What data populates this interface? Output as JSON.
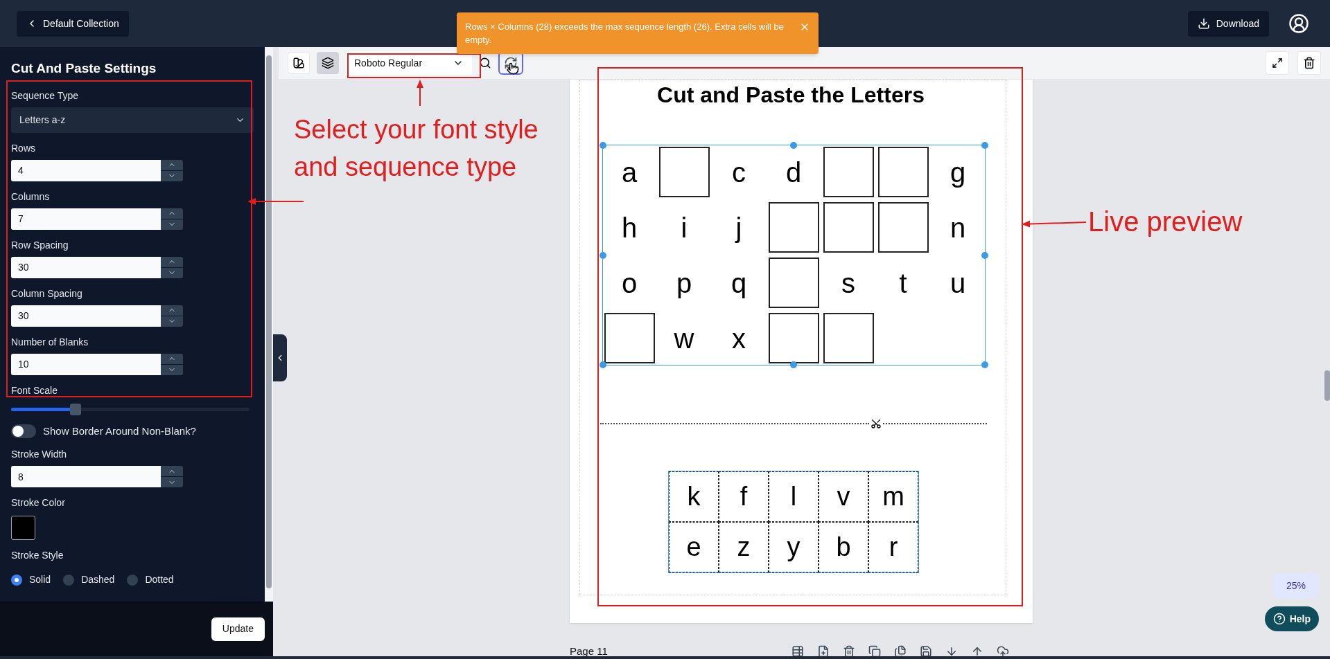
{
  "top_bar": {
    "back_button": "Default Collection",
    "download_button": "Download"
  },
  "settings_panel": {
    "title": "Cut And Paste Settings",
    "fields": [
      {
        "kind": "select",
        "label": "Sequence Type",
        "value": "Letters a-z"
      },
      {
        "kind": "number",
        "label": "Rows",
        "value": "4"
      },
      {
        "kind": "number",
        "label": "Columns",
        "value": "7"
      },
      {
        "kind": "number",
        "label": "Row Spacing",
        "value": "30"
      },
      {
        "kind": "number",
        "label": "Column Spacing",
        "value": "30"
      },
      {
        "kind": "number",
        "label": "Number of Blanks",
        "value": "10"
      },
      {
        "kind": "slider",
        "label": "Font Scale",
        "level": 0.27
      },
      {
        "kind": "toggle",
        "label": "Show Border Around Non-Blank?",
        "on": false
      },
      {
        "kind": "number",
        "label": "Stroke Width",
        "value": "8"
      },
      {
        "kind": "color",
        "label": "Stroke Color",
        "color": "#000000"
      },
      {
        "kind": "radio",
        "label": "Stroke Style",
        "options": [
          {
            "label": "Solid",
            "selected": true
          },
          {
            "label": "Dashed",
            "selected": false
          },
          {
            "label": "Dotted",
            "selected": false
          }
        ]
      }
    ],
    "update_button": "Update"
  },
  "toolbar": {
    "font_select": "Roboto Regular"
  },
  "toast": {
    "message": "Rows × Columns (28) exceeds the max sequence length (26). Extra cells will be empty."
  },
  "worksheet": {
    "title": "Cut and Paste the Letters",
    "grid": [
      [
        {
          "kind": "letter",
          "text": "a"
        },
        {
          "kind": "blank"
        },
        {
          "kind": "letter",
          "text": "c"
        },
        {
          "kind": "letter",
          "text": "d"
        },
        {
          "kind": "blank"
        },
        {
          "kind": "blank"
        },
        {
          "kind": "letter",
          "text": "g"
        }
      ],
      [
        {
          "kind": "letter",
          "text": "h"
        },
        {
          "kind": "letter",
          "text": "i"
        },
        {
          "kind": "letter",
          "text": "j"
        },
        {
          "kind": "blank"
        },
        {
          "kind": "blank"
        },
        {
          "kind": "blank"
        },
        {
          "kind": "letter",
          "text": "n"
        }
      ],
      [
        {
          "kind": "letter",
          "text": "o"
        },
        {
          "kind": "letter",
          "text": "p"
        },
        {
          "kind": "letter",
          "text": "q"
        },
        {
          "kind": "blank"
        },
        {
          "kind": "letter",
          "text": "s"
        },
        {
          "kind": "letter",
          "text": "t"
        },
        {
          "kind": "letter",
          "text": "u"
        }
      ],
      [
        {
          "kind": "blank"
        },
        {
          "kind": "letter",
          "text": "w"
        },
        {
          "kind": "letter",
          "text": "x"
        },
        {
          "kind": "blank"
        },
        {
          "kind": "blank"
        }
      ]
    ],
    "pieces": [
      [
        "k",
        "f",
        "l",
        "v",
        "m"
      ],
      [
        "e",
        "z",
        "y",
        "b",
        "r"
      ]
    ]
  },
  "zoom_badge": "25%",
  "help_button": "Help",
  "page_label": "Page 11",
  "annotations": [
    {
      "text": "Select your font style and sequence type"
    },
    {
      "text": "Live preview"
    }
  ]
}
